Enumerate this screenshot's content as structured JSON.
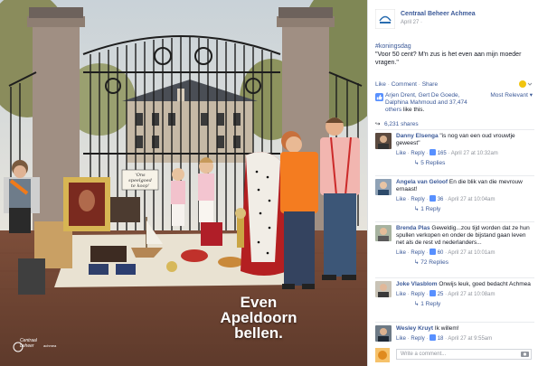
{
  "photo": {
    "caption_lines": [
      "Even",
      "Apeldoorn",
      "bellen."
    ],
    "sign_lines": [
      "'Ons",
      "speelgoed",
      "te koop'"
    ],
    "brand_name": "Centraal",
    "brand_sub": "beheer",
    "brand_tag": "achmea"
  },
  "post": {
    "page_name": "Centraal Beheer Achmea",
    "date": "April 27",
    "hashtag": "#koningsdag",
    "text": "\"Voor 50 cent? M'n zus is het even aan mijn moeder vragen.\""
  },
  "actions": {
    "like": "Like",
    "comment": "Comment",
    "share": "Share",
    "sep": "·"
  },
  "likes": {
    "text_a": "Arjen Drent, Gert De Goede, Dalphina Mahmoud and ",
    "text_b": "37,474 others",
    "text_c": " like this.",
    "sort": "Most Relevant ▾",
    "shares": "6,231 shares"
  },
  "comments": [
    {
      "author": "Danny Elsenga",
      "text": "\"is nog van een oud vrouwtje geweest\"",
      "like": "Like",
      "reply": "Reply",
      "likes": "165",
      "time": "April 27 at 10:32am",
      "replies": "5 Replies"
    },
    {
      "author": "Angela van Geloof",
      "text": "En die blik van die mevrouw ernaast!",
      "like": "Like",
      "reply": "Reply",
      "likes": "36",
      "time": "April 27 at 10:04am",
      "replies": "1 Reply"
    },
    {
      "author": "Brenda Plas",
      "text": "Geweldig...zou tijd worden dat ze hun spullen verkopen en onder de bijstand gaan leven net als de rest vd nederlanders...",
      "like": "Like",
      "reply": "Reply",
      "likes": "60",
      "time": "April 27 at 10:01am",
      "replies": "72 Replies"
    },
    {
      "author": "Joke Vlasblom",
      "text": "Onwijs leuk, goed bedacht Achmea",
      "like": "Like",
      "reply": "Reply",
      "likes": "25",
      "time": "April 27 at 10:08am",
      "replies": "1 Reply"
    },
    {
      "author": "Wesley Kruyt",
      "text": "Ik willem!",
      "like": "Like",
      "reply": "Reply",
      "likes": "18",
      "time": "April 27 at 9:55am",
      "replies": ""
    }
  ],
  "comment_box": {
    "placeholder": "Write a comment..."
  },
  "colors": {
    "link": "#3b5998",
    "meta": "#90949c",
    "orange_shirt": "#f47c20",
    "pink_shirt": "#f2b6b0"
  },
  "icons": [
    "page-logo-icon",
    "pin-icon",
    "thumbs-up-icon",
    "share-icon",
    "camera-icon",
    "avatar-icon"
  ]
}
